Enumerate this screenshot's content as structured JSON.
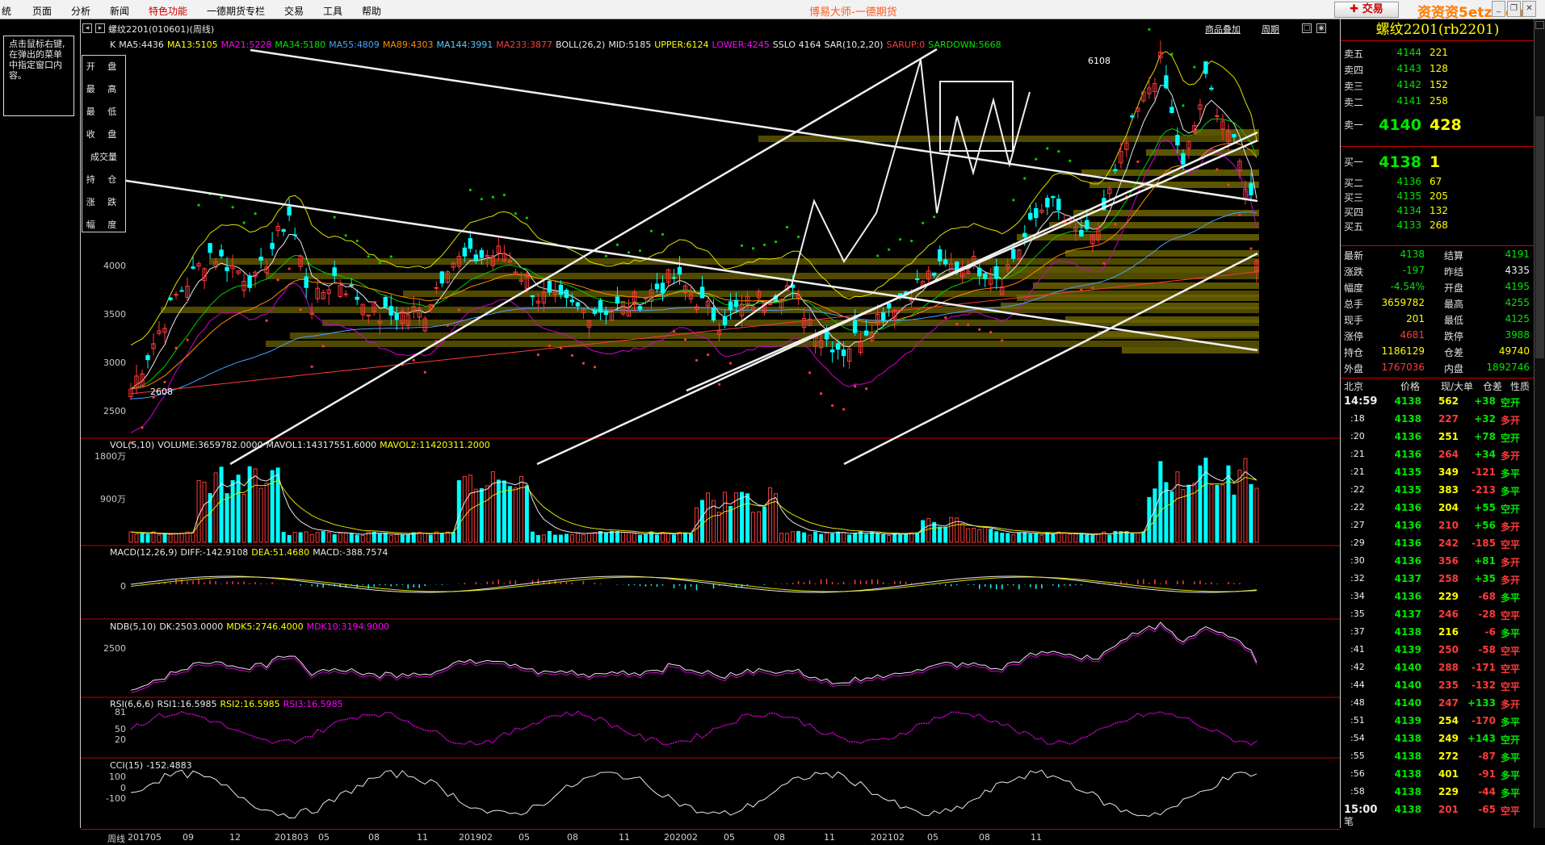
{
  "menubar": {
    "items": [
      "统",
      "页面",
      "分析",
      "新闻",
      "特色功能",
      "一德期货专栏",
      "交易",
      "工具",
      "帮助"
    ],
    "highlight_index": 4,
    "app_title": "博易大师-一德期货",
    "trade_button": "交易",
    "watermark": "资资资5etz.com"
  },
  "hint": {
    "text": "点击鼠标右键,在弹出的菜单中指定窗口内容。"
  },
  "price_fields": [
    "开 盘",
    "最 高",
    "最 低",
    "收 盘",
    "成交量",
    "持 仓",
    "涨 跌",
    "幅 度"
  ],
  "chart": {
    "title": "螺纹2201(010601)(周线)",
    "overlay_link": "商品叠加",
    "period_link": "周期",
    "main_legend": [
      {
        "text": "K",
        "color": "#e8e8e8"
      },
      {
        "text": "MA5:4436",
        "color": "#e8e8e8"
      },
      {
        "text": "MA13:5105",
        "color": "#ffff00"
      },
      {
        "text": "MA21:5228",
        "color": "#ff00ff"
      },
      {
        "text": "MA34:5180",
        "color": "#00e600"
      },
      {
        "text": "MA55:4809",
        "color": "#4aa0ff"
      },
      {
        "text": "MA89:4303",
        "color": "#ff8c00"
      },
      {
        "text": "MA144:3991",
        "color": "#5ac8ff"
      },
      {
        "text": "MA233:3877",
        "color": "#ff3a3a"
      },
      {
        "text": "BOLL(26,2)",
        "color": "#e8e8e8"
      },
      {
        "text": "MID:5185",
        "color": "#e8e8e8"
      },
      {
        "text": "UPPER:6124",
        "color": "#ffff00"
      },
      {
        "text": "LOWER:4245",
        "color": "#ff00ff"
      },
      {
        "text": "SSLO 4164",
        "color": "#e8e8e8"
      },
      {
        "text": "SAR(10,2,20)",
        "color": "#e8e8e8"
      },
      {
        "text": "SARUP:0",
        "color": "#ff3a3a"
      },
      {
        "text": "SARDOWN:5668",
        "color": "#00e600"
      }
    ],
    "price_axis": [
      "4000",
      "3500",
      "3000",
      "2500"
    ],
    "annotations": {
      "high": "6108",
      "low": "2608"
    },
    "vol": {
      "legend": [
        {
          "text": "VOL(5,10)",
          "color": "#e8e8e8"
        },
        {
          "text": "VOLUME:3659782.0000",
          "color": "#e8e8e8"
        },
        {
          "text": "MAVOL1:14317551.6000",
          "color": "#e8e8e8"
        },
        {
          "text": "MAVOL2:11420311.2000",
          "color": "#ffff00"
        }
      ],
      "axis": [
        "1800万",
        "900万"
      ]
    },
    "macd": {
      "legend": [
        {
          "text": "MACD(12,26,9)",
          "color": "#e8e8e8"
        },
        {
          "text": "DIFF:-142.9108",
          "color": "#e8e8e8"
        },
        {
          "text": "DEA:51.4680",
          "color": "#ffff00"
        },
        {
          "text": "MACD:-388.7574",
          "color": "#e8e8e8"
        }
      ],
      "axis": [
        "0"
      ]
    },
    "ndb": {
      "legend": [
        {
          "text": "NDB(5,10)",
          "color": "#e8e8e8"
        },
        {
          "text": "DK:2503.0000",
          "color": "#e8e8e8"
        },
        {
          "text": "MDK5:2746.4000",
          "color": "#ffff00"
        },
        {
          "text": "MDK10:3194.9000",
          "color": "#ff00ff"
        }
      ],
      "axis": [
        "2500"
      ]
    },
    "rsi": {
      "legend": [
        {
          "text": "RSI(6,6,6)",
          "color": "#e8e8e8"
        },
        {
          "text": "RSI1:16.5985",
          "color": "#e8e8e8"
        },
        {
          "text": "RSI2:16.5985",
          "color": "#ffff00"
        },
        {
          "text": "RSI3:16.5985",
          "color": "#ff00ff"
        }
      ],
      "axis": [
        "81",
        "50",
        "20"
      ]
    },
    "cci": {
      "legend": [
        {
          "text": "CCI(15)",
          "color": "#e8e8e8"
        },
        {
          "text": "-152.4883",
          "color": "#e8e8e8"
        }
      ],
      "axis": [
        "100",
        "0",
        "-100"
      ]
    },
    "x_axis": {
      "period_label": "周线",
      "ticks": [
        "201705",
        "09",
        "12",
        "201803",
        "05",
        "08",
        "11",
        "201902",
        "05",
        "08",
        "11",
        "202002",
        "05",
        "08",
        "11",
        "202102",
        "05",
        "08",
        "11"
      ]
    }
  },
  "quote": {
    "title": "螺纹2201(rb2201)",
    "asks": [
      {
        "label": "卖五",
        "price": "4144",
        "vol": "221"
      },
      {
        "label": "卖四",
        "price": "4143",
        "vol": "128"
      },
      {
        "label": "卖三",
        "price": "4142",
        "vol": "152"
      },
      {
        "label": "卖二",
        "price": "4141",
        "vol": "258"
      },
      {
        "label": "卖一",
        "price": "4140",
        "vol": "428"
      }
    ],
    "bids": [
      {
        "label": "买一",
        "price": "4138",
        "vol": "1"
      },
      {
        "label": "买二",
        "price": "4136",
        "vol": "67"
      },
      {
        "label": "买三",
        "price": "4135",
        "vol": "205"
      },
      {
        "label": "买四",
        "price": "4134",
        "vol": "132"
      },
      {
        "label": "买五",
        "price": "4133",
        "vol": "268"
      }
    ],
    "stats": [
      {
        "l1": "最新",
        "v1": "4138",
        "c1": "grn",
        "l2": "结算",
        "v2": "4191",
        "c2": "grn"
      },
      {
        "l1": "涨跌",
        "v1": "-197",
        "c1": "grn",
        "l2": "昨结",
        "v2": "4335",
        "c2": "wht"
      },
      {
        "l1": "幅度",
        "v1": "-4.54%",
        "c1": "grn",
        "l2": "开盘",
        "v2": "4195",
        "c2": "grn"
      },
      {
        "l1": "总手",
        "v1": "3659782",
        "c1": "yel",
        "l2": "最高",
        "v2": "4255",
        "c2": "grn"
      },
      {
        "l1": "现手",
        "v1": "201",
        "c1": "yel",
        "l2": "最低",
        "v2": "4125",
        "c2": "grn"
      },
      {
        "l1": "涨停",
        "v1": "4681",
        "c1": "red",
        "l2": "跌停",
        "v2": "3988",
        "c2": "grn"
      },
      {
        "l1": "持仓",
        "v1": "1186129",
        "c1": "yel",
        "l2": "仓差",
        "v2": "49740",
        "c2": "yel"
      },
      {
        "l1": "外盘",
        "v1": "1767036",
        "c1": "red",
        "l2": "内盘",
        "v2": "1892746",
        "c2": "grn"
      }
    ],
    "tick_header": {
      "c0": "北京",
      "c1": "价格",
      "c2": "现/大单",
      "c3": "仓差",
      "c4": "性质"
    },
    "ticks": [
      {
        "t": "14:59",
        "p": "4138",
        "v": "562",
        "vc": "yel",
        "d": "+38",
        "n": "空开",
        "nc": "grn"
      },
      {
        "t": ":18",
        "p": "4138",
        "v": "227",
        "vc": "red",
        "d": "+32",
        "n": "多开",
        "nc": "red"
      },
      {
        "t": ":20",
        "p": "4136",
        "v": "251",
        "vc": "yel",
        "d": "+78",
        "n": "空开",
        "nc": "grn"
      },
      {
        "t": ":21",
        "p": "4136",
        "v": "264",
        "vc": "red",
        "d": "+34",
        "n": "多开",
        "nc": "red"
      },
      {
        "t": ":21",
        "p": "4135",
        "v": "349",
        "vc": "yel",
        "d": "-121",
        "n": "多平",
        "nc": "grn"
      },
      {
        "t": ":22",
        "p": "4135",
        "v": "383",
        "vc": "yel",
        "d": "-213",
        "n": "多平",
        "nc": "grn"
      },
      {
        "t": ":22",
        "p": "4136",
        "v": "204",
        "vc": "yel",
        "d": "+55",
        "n": "空开",
        "nc": "grn"
      },
      {
        "t": ":27",
        "p": "4136",
        "v": "210",
        "vc": "red",
        "d": "+56",
        "n": "多开",
        "nc": "red"
      },
      {
        "t": ":29",
        "p": "4136",
        "v": "242",
        "vc": "red",
        "d": "-185",
        "n": "空平",
        "nc": "red"
      },
      {
        "t": ":30",
        "p": "4136",
        "v": "356",
        "vc": "red",
        "d": "+81",
        "n": "多开",
        "nc": "red"
      },
      {
        "t": ":32",
        "p": "4137",
        "v": "258",
        "vc": "red",
        "d": "+35",
        "n": "多开",
        "nc": "red"
      },
      {
        "t": ":34",
        "p": "4136",
        "v": "229",
        "vc": "yel",
        "d": "-68",
        "n": "多平",
        "nc": "grn"
      },
      {
        "t": ":35",
        "p": "4137",
        "v": "246",
        "vc": "red",
        "d": "-28",
        "n": "空平",
        "nc": "red"
      },
      {
        "t": ":37",
        "p": "4138",
        "v": "216",
        "vc": "yel",
        "d": "-6",
        "n": "多平",
        "nc": "grn"
      },
      {
        "t": ":41",
        "p": "4139",
        "v": "250",
        "vc": "red",
        "d": "-58",
        "n": "空平",
        "nc": "red"
      },
      {
        "t": ":42",
        "p": "4140",
        "v": "288",
        "vc": "red",
        "d": "-171",
        "n": "空平",
        "nc": "red"
      },
      {
        "t": ":44",
        "p": "4140",
        "v": "235",
        "vc": "red",
        "d": "-132",
        "n": "空平",
        "nc": "red"
      },
      {
        "t": ":48",
        "p": "4140",
        "v": "247",
        "vc": "red",
        "d": "+133",
        "n": "多开",
        "nc": "red"
      },
      {
        "t": ":51",
        "p": "4139",
        "v": "254",
        "vc": "yel",
        "d": "-170",
        "n": "多平",
        "nc": "grn"
      },
      {
        "t": ":54",
        "p": "4138",
        "v": "249",
        "vc": "yel",
        "d": "+143",
        "n": "空开",
        "nc": "grn"
      },
      {
        "t": ":55",
        "p": "4138",
        "v": "272",
        "vc": "yel",
        "d": "-87",
        "n": "多平",
        "nc": "grn"
      },
      {
        "t": ":56",
        "p": "4138",
        "v": "401",
        "vc": "yel",
        "d": "-91",
        "n": "多平",
        "nc": "grn"
      },
      {
        "t": ":58",
        "p": "4138",
        "v": "229",
        "vc": "yel",
        "d": "-44",
        "n": "多平",
        "nc": "grn"
      },
      {
        "t": "15:00",
        "p": "4138",
        "v": "201",
        "vc": "red",
        "d": "-65",
        "n": "空平",
        "nc": "red"
      }
    ],
    "footer_tab": "笔"
  }
}
